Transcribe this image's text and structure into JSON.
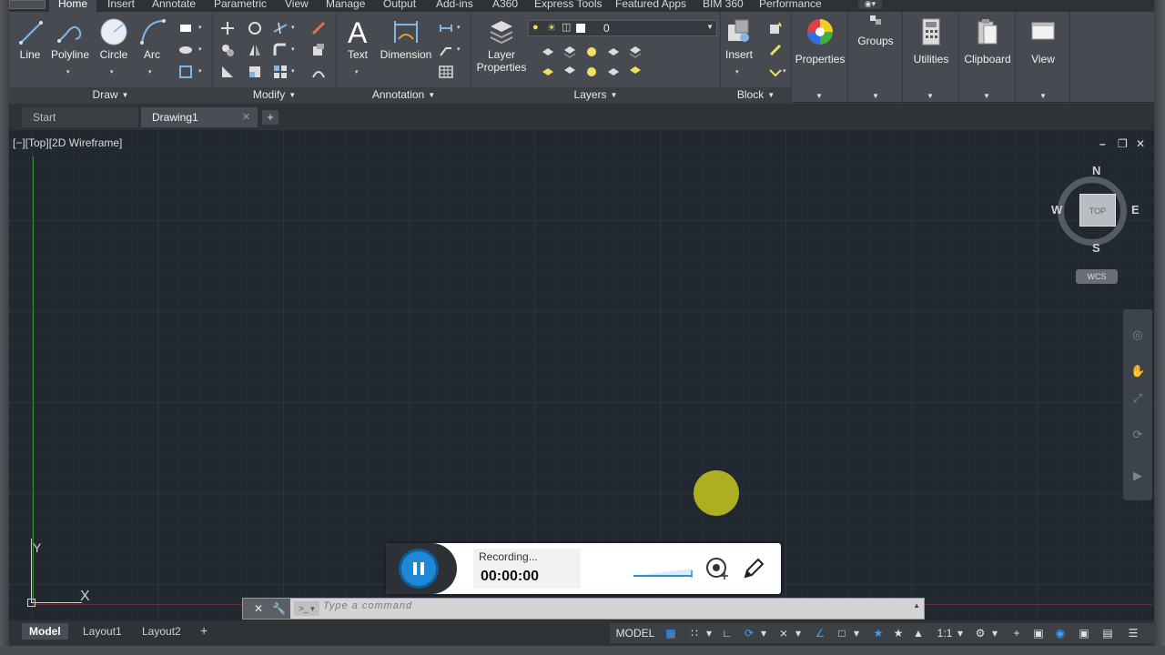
{
  "ribbon_tabs": [
    "Home",
    "Insert",
    "Annotate",
    "Parametric",
    "View",
    "Manage",
    "Output",
    "Add-ins",
    "A360",
    "Express Tools",
    "Featured Apps",
    "BIM 360",
    "Performance"
  ],
  "draw_panel": {
    "title": "Draw",
    "tools": [
      "Line",
      "Polyline",
      "Circle",
      "Arc"
    ]
  },
  "modify_panel": {
    "title": "Modify"
  },
  "annotation_panel": {
    "title": "Annotation",
    "tools": [
      "Text",
      "Dimension"
    ]
  },
  "layers_panel": {
    "title": "Layers",
    "tool": "Layer\nProperties",
    "tool_line1": "Layer",
    "tool_line2": "Properties",
    "current_layer": "0"
  },
  "block_panel": {
    "title": "Block",
    "tool": "Insert"
  },
  "right_tools": [
    "Properties",
    "Groups",
    "Utilities",
    "Clipboard",
    "View"
  ],
  "file_tabs": [
    {
      "label": "Start"
    },
    {
      "label": "Drawing1"
    }
  ],
  "viewport": {
    "label": "[−][Top][2D Wireframe]",
    "minimize": "–",
    "restore": "❐",
    "close": "✕"
  },
  "ucs": {
    "x": "X",
    "y": "Y"
  },
  "viewcube": {
    "face": "TOP",
    "n": "N",
    "s": "S",
    "e": "E",
    "w": "W",
    "wcs": "WCS"
  },
  "recorder": {
    "status": "Recording...",
    "time": "00:00:00"
  },
  "command_line": {
    "placeholder": "Type a command"
  },
  "layout_tabs": [
    "Model",
    "Layout1",
    "Layout2"
  ],
  "status_bar": {
    "model": "MODEL",
    "scale": "1:1"
  },
  "colors": {
    "ribbon_bg": "#474b51",
    "canvas_bg": "#212830",
    "accent_blue": "#1e88d6",
    "cursor_dot": "#b5b520"
  }
}
